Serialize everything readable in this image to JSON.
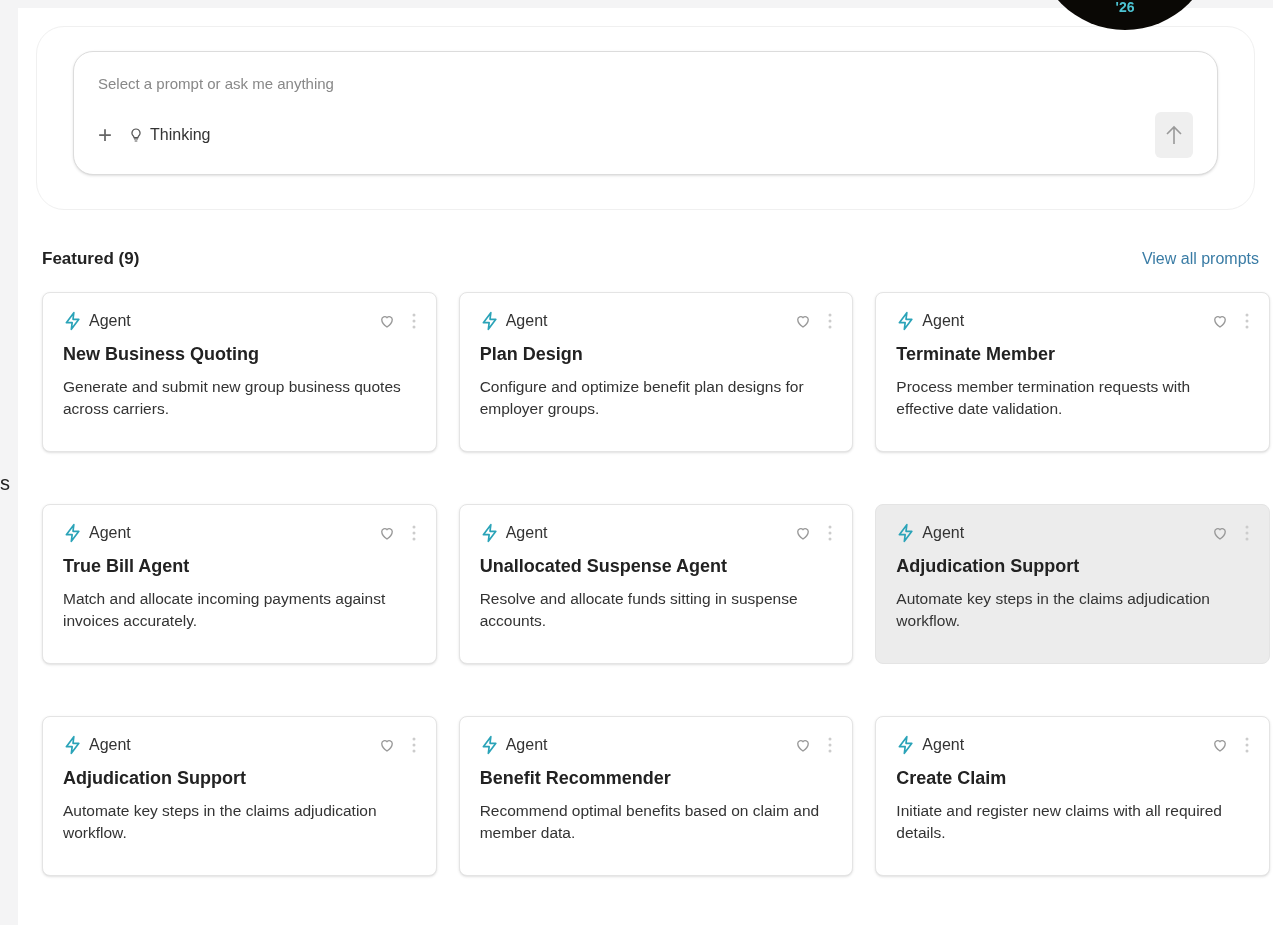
{
  "edge_text": "s",
  "badge": {
    "text": "'26"
  },
  "prompt": {
    "placeholder": "Select a prompt or ask me anything",
    "add_label": "+",
    "thinking_label": "Thinking"
  },
  "featured": {
    "title": "Featured (9)",
    "link": "View all prompts"
  },
  "cards": [
    {
      "tag": "Agent",
      "title": "New Business Quoting",
      "description": "Generate and submit new group business quotes across carriers.",
      "highlighted": false
    },
    {
      "tag": "Agent",
      "title": "Plan Design",
      "description": "Configure and optimize benefit plan designs for employer groups.",
      "highlighted": false
    },
    {
      "tag": "Agent",
      "title": "Terminate Member",
      "description": "Process member termination requests with effective date validation.",
      "highlighted": false
    },
    {
      "tag": "Agent",
      "title": "True Bill Agent",
      "description": "Match and allocate incoming payments against invoices accurately.",
      "highlighted": false
    },
    {
      "tag": "Agent",
      "title": "Unallocated Suspense Agent",
      "description": "Resolve and allocate funds sitting in suspense accounts.",
      "highlighted": false
    },
    {
      "tag": "Agent",
      "title": "Adjudication Support",
      "description": "Automate key steps in the claims adjudication workflow.",
      "highlighted": true
    },
    {
      "tag": "Agent",
      "title": "Adjudication Support",
      "description": "Automate key steps in the claims adjudication workflow.",
      "highlighted": false
    },
    {
      "tag": "Agent",
      "title": "Benefit Recommender",
      "description": "Recommend optimal benefits based on claim and member data.",
      "highlighted": false
    },
    {
      "tag": "Agent",
      "title": "Create Claim",
      "description": "Initiate and register new claims with all required details.",
      "highlighted": false
    }
  ]
}
